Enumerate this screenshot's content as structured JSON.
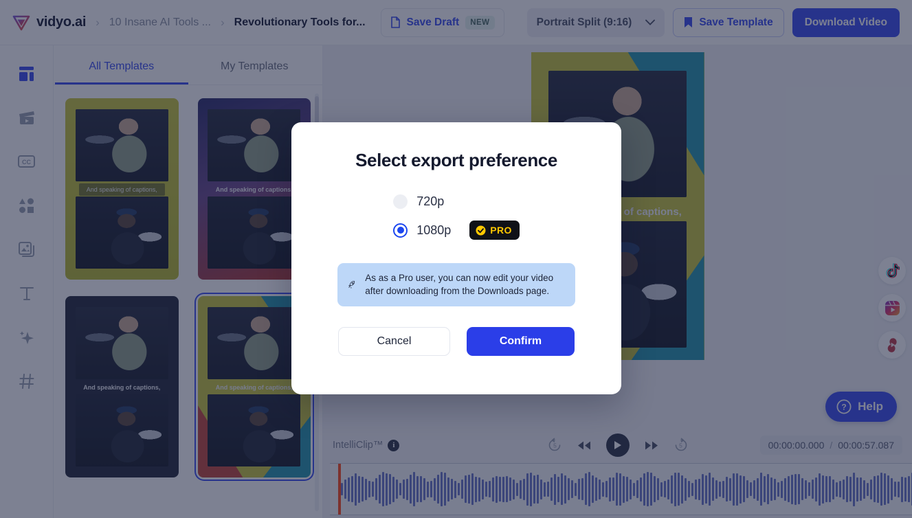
{
  "header": {
    "brand": "vidyo.ai",
    "breadcrumbs": [
      {
        "label": "10 Insane AI Tools ...",
        "active": false
      },
      {
        "label": "Revolutionary Tools for...",
        "active": true
      }
    ],
    "save_draft_label": "Save Draft",
    "new_badge": "NEW",
    "ratio_value": "Portrait Split (9:16)",
    "save_template_label": "Save Template",
    "download_label": "Download Video"
  },
  "sidebar": {
    "items": [
      {
        "name": "templates",
        "icon": "layout-icon",
        "active": true
      },
      {
        "name": "clips",
        "icon": "clapperboard-icon",
        "active": false
      },
      {
        "name": "captions",
        "icon": "cc-icon",
        "active": false
      },
      {
        "name": "elements",
        "icon": "shapes-icon",
        "active": false
      },
      {
        "name": "media",
        "icon": "images-icon",
        "active": false
      },
      {
        "name": "text",
        "icon": "text-icon",
        "active": false
      },
      {
        "name": "effects",
        "icon": "sparkle-icon",
        "active": false
      },
      {
        "name": "hashtags",
        "icon": "hashtag-icon",
        "active": false
      }
    ]
  },
  "templates_panel": {
    "tabs": [
      {
        "label": "All Templates",
        "active": true
      },
      {
        "label": "My Templates",
        "active": false
      }
    ],
    "cards": [
      {
        "id": "tpl-a",
        "caption": "And speaking of captions,",
        "selected": false
      },
      {
        "id": "tpl-b",
        "caption": "And speaking of captions,",
        "selected": false
      },
      {
        "id": "tpl-c",
        "caption": "And speaking of captions,",
        "selected": false
      },
      {
        "id": "tpl-d",
        "caption": "And speaking of captions,",
        "selected": true
      }
    ]
  },
  "preview": {
    "caption": "And speaking of captions,",
    "social": [
      {
        "name": "tiktok-icon"
      },
      {
        "name": "instagram-reels-icon"
      },
      {
        "name": "youtube-shorts-icon"
      }
    ]
  },
  "help": {
    "label": "Help"
  },
  "timeline": {
    "intelliclip_label": "IntelliClip™",
    "info_glyph": "i",
    "current_time": "00:00:00.000",
    "separator": "/",
    "total_time": "00:00:57.087",
    "controls": [
      {
        "name": "rewind-5s-button",
        "glyph": "5"
      },
      {
        "name": "skip-back-button"
      },
      {
        "name": "play-button"
      },
      {
        "name": "skip-forward-button"
      },
      {
        "name": "forward-5s-button",
        "glyph": "5"
      }
    ]
  },
  "modal": {
    "title": "Select export preference",
    "options": [
      {
        "label": "720p",
        "selected": false,
        "pro": false
      },
      {
        "label": "1080p",
        "selected": true,
        "pro": true
      }
    ],
    "pro_badge": "PRO",
    "notice": "As as a Pro user, you can now edit your video after downloading from the Downloads page.",
    "cancel_label": "Cancel",
    "confirm_label": "Confirm"
  },
  "colors": {
    "accent": "#3b4ff0",
    "confirm": "#2b3ee8",
    "radio_on": "#1b46f0",
    "pro_yellow": "#ffc800",
    "pro_bg": "#0f1117",
    "notice_bg": "#bdd7f8",
    "playhead": "#ff4d1c",
    "waveform": "#6a76c8",
    "new_badge_bg": "#e7f3ef"
  }
}
